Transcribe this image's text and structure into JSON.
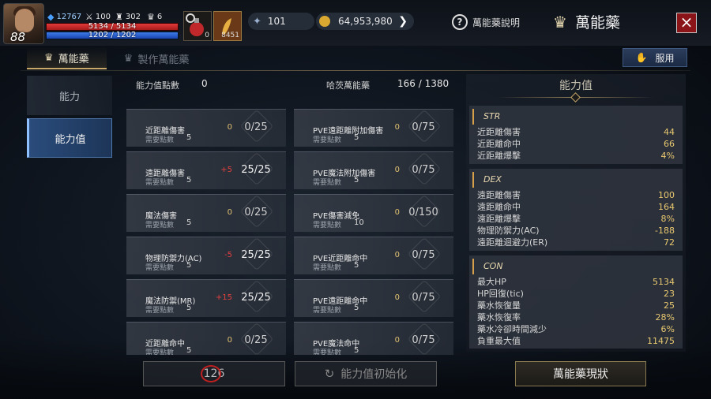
{
  "player": {
    "level": "88",
    "exp": "12767",
    "stat_a": "100",
    "stat_b": "302",
    "stat_c": "6",
    "hp_text": "5134 / 5134",
    "hp_fraction": 1,
    "mp_text": "1202 / 1202",
    "mp_fraction": 1
  },
  "slots": {
    "potion_count": "0",
    "elixir_count": "8451"
  },
  "currency": {
    "gem": "101",
    "gold": "64,953,980"
  },
  "header": {
    "help_label": "萬能藥說明",
    "title": "萬能藥",
    "close_icon": "×"
  },
  "tabs": [
    {
      "label": "萬能藥",
      "active": true
    },
    {
      "label": "製作萬能藥",
      "active": false
    }
  ],
  "use_button": "服用",
  "nav": [
    {
      "label": "能力",
      "active": false
    },
    {
      "label": "能力值",
      "active": true
    }
  ],
  "summary": {
    "points_label": "能力值點數",
    "points_value": "0",
    "elixir_label": "哈茨萬能藥",
    "elixir_value": "166 / 1380"
  },
  "cards_left": [
    {
      "name": "近距離傷害",
      "req_label": "需要點數",
      "req": "5",
      "bonus": "0",
      "progress": "0/25"
    },
    {
      "name": "遠距離傷害",
      "req_label": "需要點數",
      "req": "5",
      "bonus": "+5",
      "progress": "25/25"
    },
    {
      "name": "魔法傷害",
      "req_label": "需要點數",
      "req": "5",
      "bonus": "0",
      "progress": "0/25"
    },
    {
      "name": "物理防禦力(AC)",
      "req_label": "需要點數",
      "req": "5",
      "bonus": "-5",
      "progress": "25/25"
    },
    {
      "name": "魔法防禦(MR)",
      "req_label": "需要點數",
      "req": "5",
      "bonus": "+15",
      "progress": "25/25"
    },
    {
      "name": "近距離命中",
      "req_label": "需要點數",
      "req": "5",
      "bonus": "0",
      "progress": "0/25"
    }
  ],
  "cards_right": [
    {
      "name": "PVE遠距離附加傷害",
      "req_label": "需要點數",
      "req": "5",
      "bonus": "0",
      "progress": "0/75"
    },
    {
      "name": "PVE魔法附加傷害",
      "req_label": "需要點數",
      "req": "5",
      "bonus": "0",
      "progress": "0/75"
    },
    {
      "name": "PVE傷害減免",
      "req_label": "需要點數",
      "req": "10",
      "bonus": "0",
      "progress": "0/150"
    },
    {
      "name": "PVE近距離命中",
      "req_label": "需要點數",
      "req": "5",
      "bonus": "0",
      "progress": "0/75"
    },
    {
      "name": "PVE遠距離命中",
      "req_label": "需要點數",
      "req": "5",
      "bonus": "0",
      "progress": "0/75"
    },
    {
      "name": "PVE魔法命中",
      "req_label": "需要點數",
      "req": "5",
      "bonus": "0",
      "progress": "0/75"
    }
  ],
  "stats_panel": {
    "title": "能力值",
    "groups": [
      {
        "name": "STR",
        "rows": [
          {
            "label": "近距離傷害",
            "value": "44"
          },
          {
            "label": "近距離命中",
            "value": "66"
          },
          {
            "label": "近距離爆擊",
            "value": "4%"
          }
        ]
      },
      {
        "name": "DEX",
        "rows": [
          {
            "label": "遠距離傷害",
            "value": "100"
          },
          {
            "label": "遠距離命中",
            "value": "164"
          },
          {
            "label": "遠距離爆擊",
            "value": "8%"
          },
          {
            "label": "物理防禦力(AC)",
            "value": "-188"
          },
          {
            "label": "遠距離迴避力(ER)",
            "value": "72"
          }
        ]
      },
      {
        "name": "CON",
        "rows": [
          {
            "label": "最大HP",
            "value": "5134"
          },
          {
            "label": "HP回復(tic)",
            "value": "23"
          },
          {
            "label": "藥水恢復量",
            "value": "25"
          },
          {
            "label": "藥水恢復率",
            "value": "28%"
          },
          {
            "label": "藥水冷卻時間減少",
            "value": "6%"
          },
          {
            "label": "負重最大值",
            "value": "11475"
          }
        ]
      }
    ]
  },
  "bottom": {
    "disabled_count": "126",
    "reset_label": "能力值初始化",
    "status_label": "萬能藥現狀"
  },
  "colors": {
    "accent_gold": "#c9a96a",
    "active_nav": "#2a4c7c",
    "close_red": "#8a1418",
    "bonus_red": "#e24040",
    "value_yellow": "#e8c870"
  }
}
